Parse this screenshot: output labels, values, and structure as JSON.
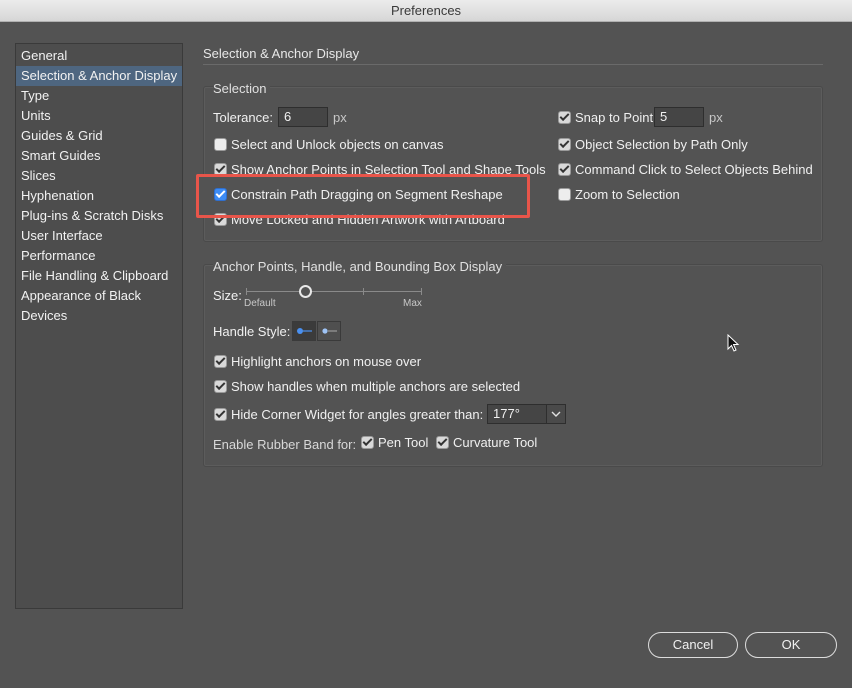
{
  "window": {
    "title": "Preferences"
  },
  "sidebar": {
    "items": [
      {
        "label": "General"
      },
      {
        "label": "Selection & Anchor Display"
      },
      {
        "label": "Type"
      },
      {
        "label": "Units"
      },
      {
        "label": "Guides & Grid"
      },
      {
        "label": "Smart Guides"
      },
      {
        "label": "Slices"
      },
      {
        "label": "Hyphenation"
      },
      {
        "label": "Plug-ins & Scratch Disks"
      },
      {
        "label": "User Interface"
      },
      {
        "label": "Performance"
      },
      {
        "label": "File Handling & Clipboard"
      },
      {
        "label": "Appearance of Black"
      },
      {
        "label": "Devices"
      }
    ],
    "selected": "Selection & Anchor Display"
  },
  "panel": {
    "title": "Selection & Anchor Display"
  },
  "selection": {
    "title": "Selection",
    "tolerance_label": "Tolerance:",
    "tolerance_value": "6",
    "tolerance_unit": "px",
    "select_unlock_label": "Select and Unlock objects on canvas",
    "show_anchor_points_label": "Show Anchor Points in Selection Tool and Shape Tools",
    "constrain_path_label": "Constrain Path Dragging on Segment Reshape",
    "move_locked_label": "Move Locked and Hidden Artwork with Artboard",
    "snap_to_point_label": "Snap to Point",
    "snap_value": "5",
    "snap_unit": "px",
    "object_selection_label": "Object Selection by Path Only",
    "command_click_label": "Command Click to Select Objects Behind",
    "zoom_to_selection_label": "Zoom to Selection"
  },
  "anchor": {
    "title": "Anchor Points, Handle, and Bounding Box Display",
    "size_label": "Size:",
    "size_min_label": "Default",
    "size_max_label": "Max",
    "handle_style_label": "Handle Style:",
    "highlight_anchors_label": "Highlight anchors on mouse over",
    "show_handles_label": "Show handles when multiple anchors are selected",
    "hide_corner_label": "Hide Corner Widget for angles greater than:",
    "corner_angle_value": "177°",
    "rubber_band_label": "Enable Rubber Band for:",
    "pen_tool_label": "Pen Tool",
    "curvature_tool_label": "Curvature Tool"
  },
  "buttons": {
    "cancel": "Cancel",
    "ok": "OK"
  },
  "colors": {
    "highlight_box": "#e8554a",
    "selected_item": "#4e6680",
    "checkbox_active": "#3d8cf5"
  }
}
